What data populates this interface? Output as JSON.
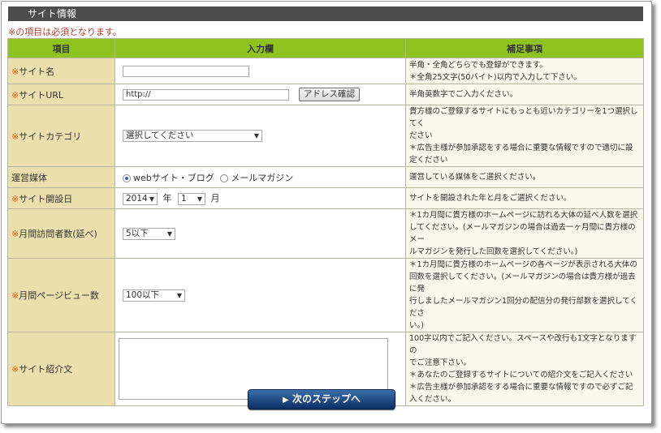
{
  "section_title": "サイト情報",
  "required_note": "※の項目は必須となります。",
  "required_mark": "※",
  "table_headers": {
    "item": "項目",
    "input": "入力欄",
    "note": "補足事項"
  },
  "rows": {
    "site_name": {
      "label": "サイト名",
      "value": "",
      "note_lines": [
        "半角・全角どちらでも登録ができます。",
        "＊全角25文字(50バイト)以内で入力して下さい。"
      ]
    },
    "site_url": {
      "label": "サイトURL",
      "value": "http://",
      "button": "アドレス確認",
      "note_lines": [
        "半角英数字でご入力ください。"
      ]
    },
    "site_category": {
      "label": "サイトカテゴリ",
      "selected": "選択してください",
      "note_lines": [
        "貴方様のご登録するサイトにもっとも近いカテゴリーを1つ選択してく",
        "ださい",
        "＊広告主様が参加承認をする場合に重要な情報ですので適切に設",
        "定ください"
      ]
    },
    "media": {
      "label": "運営媒体",
      "option_web": "webサイト・ブログ",
      "option_mail": "メールマガジン",
      "selected": "webサイト・ブログ",
      "note_lines": [
        "運営している媒体をご選択ください。"
      ]
    },
    "open_date": {
      "label": "サイト開設日",
      "year": "2014",
      "year_unit": "年",
      "month": "1",
      "month_unit": "月",
      "note_lines": [
        "サイトを開設された年と月をご選択ください。"
      ]
    },
    "monthly_visitors": {
      "label": "月間訪問者数(延べ)",
      "selected": "5以下",
      "note_lines": [
        "＊1カ月間に貴方様のホームページに訪れる大体の延べ人数を選択",
        "してください。(メールマガジンの場合は過去一ヶ月間に貴方様のメー",
        "ルマガジンを発行した回数を選択してください。)"
      ]
    },
    "monthly_pageviews": {
      "label": "月間ページビュー数",
      "selected": "100以下",
      "note_lines": [
        "＊1カ月間に貴方様のホームページの各ページが表示される大体の",
        "回数を選択してください。(メールマガジンの場合は貴方様が過去に発",
        "行しましたメールマガジン1回分の配信分の発行部数を選択してくださ",
        "い。)"
      ]
    },
    "site_intro": {
      "label": "サイト紹介文",
      "value": "",
      "note_lines": [
        "100字以内でご記入ください。スペースや改行も1文字となりますの",
        "でご注意下さい。",
        "＊あなたのご登録するサイトについての紹介文をご記入ください",
        "＊広告主様が参加承認をする場合に重要な情報ですので必ずご記",
        "入ください。"
      ]
    }
  },
  "next_button": "次のステップへ",
  "icons": {
    "play": "play-icon",
    "dropdown": "chevron-down-icon"
  },
  "colors": {
    "header_green": "#8fc31f",
    "label_bg": "#ecdfae",
    "mark": "#e65c00",
    "note_bg": "#f8f8ec"
  }
}
